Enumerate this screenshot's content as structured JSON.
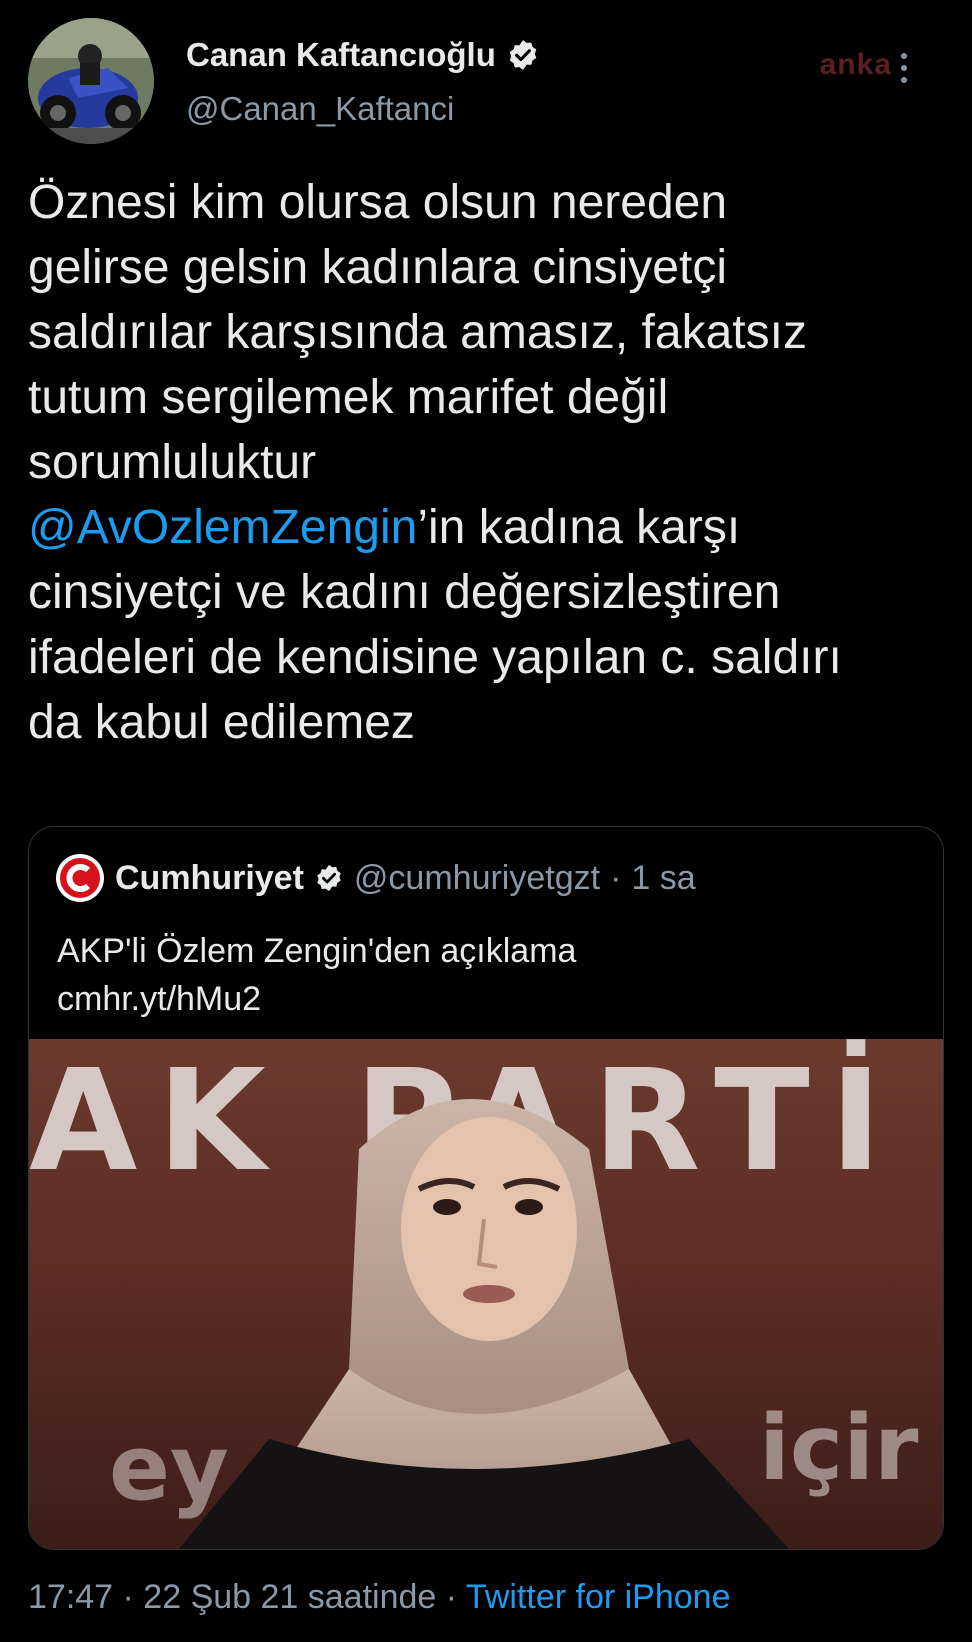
{
  "author": {
    "display_name": "Canan Kaftancıoğlu",
    "handle": "@Canan_Kaftanci",
    "verified_icon": "verified-badge-icon",
    "avatar_icon": "profile-avatar-motorcycle"
  },
  "watermark": "anka",
  "tweet": {
    "lines": [
      "Öznesi kim olursa olsun nereden",
      "gelirse gelsin kadınlara cinsiyetçi",
      "saldırılar karşısında amasız, fakatsız",
      "tutum sergilemek marifet değil",
      "sorumluluktur"
    ],
    "mention": "@AvOzlemZengin",
    "after_mention": "’in kadına karşı",
    "lines_after": [
      "cinsiyetçi ve kadını değersizleştiren",
      "ifadeleri de kendisine yapılan c. saldırı",
      "da kabul edilemez"
    ]
  },
  "quote": {
    "display_name": "Cumhuriyet",
    "handle": "@cumhuriyetgzt",
    "separator": "·",
    "time": "1 sa",
    "text_line1": "AKP'li Özlem Zengin'den açıklama",
    "text_line2": "cmhr.yt/hMu2",
    "logo_icon": "cumhuriyet-logo-icon",
    "image_text_top": "AK PARTİ",
    "image_text_bottom_left": "ey",
    "image_text_bottom_right": "içir"
  },
  "footer": {
    "timestamp": "17:47 · 22 Şub 21 saatinde · ",
    "source": "Twitter for iPhone"
  },
  "colors": {
    "background": "#000000",
    "text": "#e7e9ea",
    "secondary": "#8b98a5",
    "link": "#1d9bf0",
    "border": "#2f3336"
  }
}
